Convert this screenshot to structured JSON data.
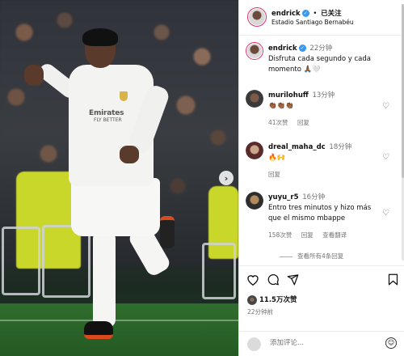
{
  "header": {
    "username": "endrick",
    "follow_status": "已关注",
    "separator": "•",
    "location": "Estadio Santiago Bernabéu"
  },
  "caption": {
    "username": "endrick",
    "time": "22分钟",
    "text": "Disfruta cada segundo y cada momento 🙏🏾🤍"
  },
  "comments": [
    {
      "username": "murilohuff",
      "time": "13分钟",
      "text": "👏🏾👏🏾👏🏾",
      "likes": "41次赞",
      "reply": "回复"
    },
    {
      "username": "dreal_maha_dc",
      "time": "18分钟",
      "text": "🔥🙌",
      "reply": "回复"
    },
    {
      "username": "yuyu_r5",
      "time": "16分钟",
      "text": "Entro tres minutos y hizo más que el mismo mbappe",
      "likes": "158次赞",
      "reply": "回复",
      "translate": "查看翻译"
    }
  ],
  "view_all_replies": "查看所有4条回复",
  "post": {
    "likes_count": "11.5万次赞",
    "time_ago": "22分钟前"
  },
  "comment_input": {
    "placeholder": "添加评论..."
  },
  "jersey": {
    "sponsor": "Emirates",
    "sponsor_sub": "FLY BETTER"
  },
  "icons": {
    "heart": "heart-icon",
    "comment": "comment-icon",
    "share": "share-icon",
    "bookmark": "bookmark-icon",
    "next": "chevron-right-icon",
    "emoji": "emoji-icon"
  },
  "colors": {
    "verified": "#3897f0",
    "story_ring": "#e1306c",
    "secondary_text": "#737373"
  }
}
